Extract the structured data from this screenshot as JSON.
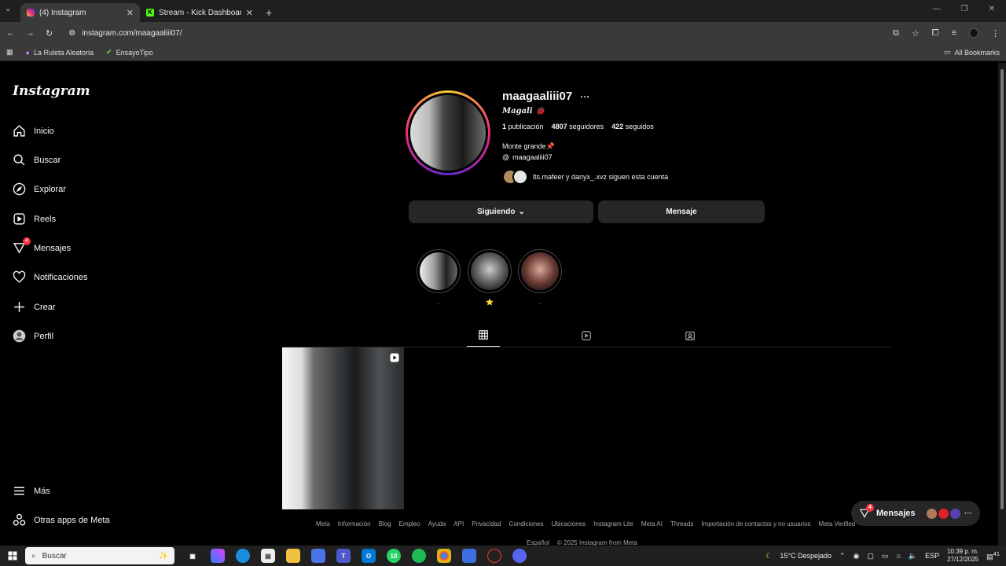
{
  "browser": {
    "tabs": [
      {
        "title": "(4) Instagram",
        "active": true
      },
      {
        "title": "Stream - Kick Dashboard",
        "active": false
      }
    ],
    "url": "instagram.com/maagaaliii07/",
    "bookmarks": [
      "La Ruleta Aleatoria",
      "EnsayoTipo"
    ],
    "all_bookmarks": "All Bookmarks"
  },
  "sidebar": {
    "logo": "Instagram",
    "items": [
      {
        "label": "Inicio",
        "icon": "home-icon"
      },
      {
        "label": "Buscar",
        "icon": "search-icon"
      },
      {
        "label": "Explorar",
        "icon": "compass-icon"
      },
      {
        "label": "Reels",
        "icon": "reels-icon"
      },
      {
        "label": "Mensajes",
        "icon": "messenger-icon",
        "badge": "4"
      },
      {
        "label": "Notificaciones",
        "icon": "heart-icon"
      },
      {
        "label": "Crear",
        "icon": "plus-icon"
      },
      {
        "label": "Perfil",
        "icon": "profile-avatar-icon"
      }
    ],
    "bottom": [
      {
        "label": "Más",
        "icon": "menu-icon"
      },
      {
        "label": "Otras apps de Meta",
        "icon": "meta-apps-icon"
      }
    ]
  },
  "profile": {
    "username": "maagaaliii07",
    "full_name": "𝑴𝒂𝒈𝒂𝒍𝒊 🐞",
    "posts": "1",
    "posts_label": "publicación",
    "followers": "4807",
    "followers_label": "seguidores",
    "following": "422",
    "following_label": "seguidos",
    "bio": "Monte grande📌",
    "threads_handle": "maagaaliii07",
    "followed_by": "lts.mafeer y danyx_.xvz siguen esta cuenta",
    "follow_button": "Siguiendo",
    "message_button": "Mensaje"
  },
  "highlights": [
    {
      "label": "."
    },
    {
      "label": "⭐"
    },
    {
      "label": "."
    }
  ],
  "footer": {
    "links": [
      "Meta",
      "Información",
      "Blog",
      "Empleo",
      "Ayuda",
      "API",
      "Privacidad",
      "Condiciones",
      "Ubicaciones",
      "Instagram Lite",
      "Meta AI",
      "Threads",
      "Importación de contactos y no usuarios",
      "Meta Verified"
    ],
    "language": "Español",
    "copyright": "© 2025 Instagram from Meta"
  },
  "messages_pill": {
    "label": "Mensajes",
    "badge": "4"
  },
  "taskbar": {
    "search_placeholder": "Buscar",
    "weather": "15°C  Despejado",
    "lang": "ESP",
    "time": "10:39 p. m.",
    "date": "27/12/2025",
    "notif_count": "41",
    "whatsapp_badge": "18"
  },
  "colors": {
    "background": "#000000",
    "button": "#262626",
    "badge": "#ff3040"
  }
}
